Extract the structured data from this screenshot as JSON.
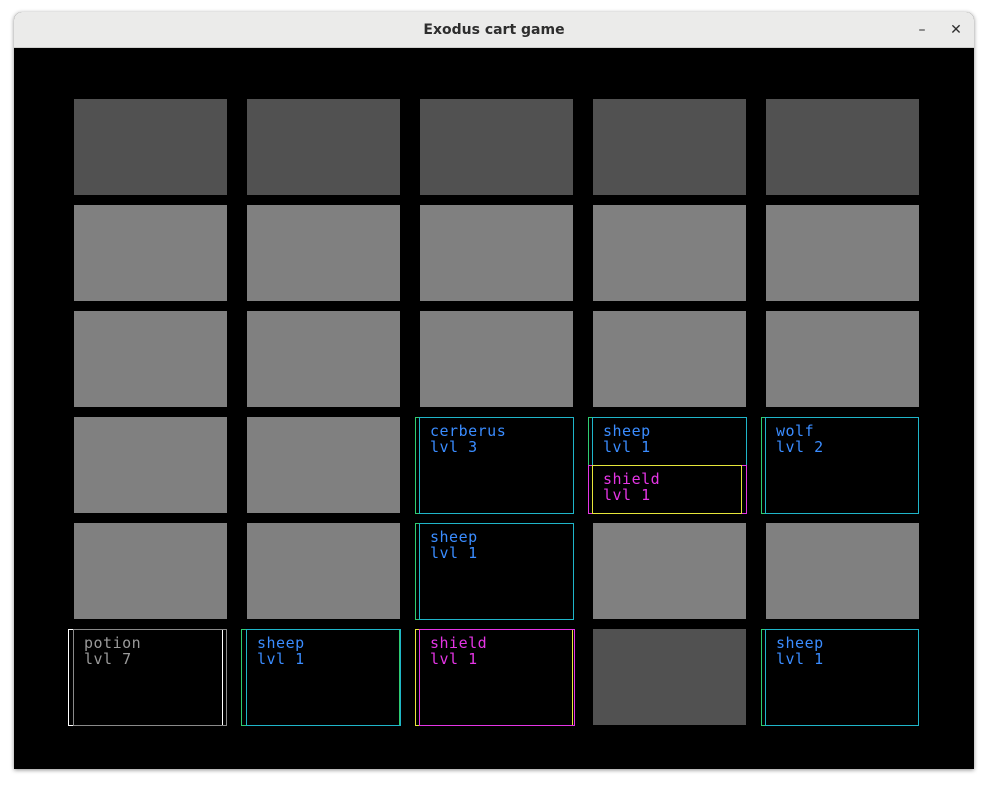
{
  "window": {
    "title": "Exodus cart game",
    "minimize_label": "–",
    "close_label": "✕"
  },
  "colors": {
    "empty_dark": "#515151",
    "empty_light": "#808080",
    "creature_text": "#3a8cff",
    "item_text": "#e535e5",
    "potion_text": "#9a9a9a"
  },
  "cards": {
    "cerberus": {
      "name": "cerberus",
      "level": "lvl 3"
    },
    "sheep_r3c3": {
      "name": "sheep",
      "level": "lvl 1"
    },
    "shield_r3c3": {
      "name": "shield",
      "level": "lvl 1"
    },
    "wolf": {
      "name": "wolf",
      "level": "lvl 2"
    },
    "sheep_r4c2": {
      "name": "sheep",
      "level": "lvl 1"
    },
    "potion": {
      "name": "potion",
      "level": "lvl 7"
    },
    "sheep_r5c1": {
      "name": "sheep",
      "level": "lvl 1"
    },
    "shield_r5c2": {
      "name": "shield",
      "level": "lvl 1"
    },
    "sheep_r5c4": {
      "name": "sheep",
      "level": "lvl 1"
    }
  }
}
